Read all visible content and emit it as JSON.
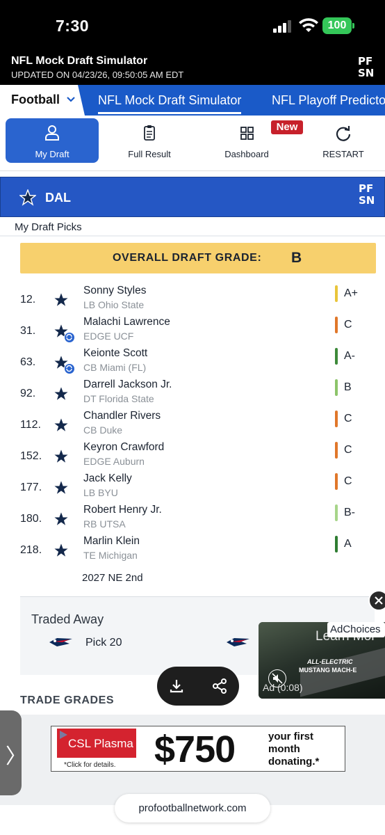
{
  "status_bar": {
    "time": "7:30",
    "battery": "100"
  },
  "app_header": {
    "title": "NFL Mock Draft Simulator",
    "updated": "UPDATED ON 04/23/26, 09:50:05 AM EDT",
    "logo_top": "PF",
    "logo_bottom": "SN"
  },
  "nav": {
    "sport": "Football",
    "tabs": [
      {
        "label": "NFL Mock Draft Simulator",
        "active": true
      },
      {
        "label": "NFL Playoff Predictor",
        "active": false
      }
    ]
  },
  "toolbar": {
    "items": [
      {
        "label": "My Draft",
        "icon": "user-icon",
        "active": true
      },
      {
        "label": "Full Result",
        "icon": "clipboard-icon",
        "active": false
      },
      {
        "label": "Dashboard",
        "icon": "dashboard-icon",
        "active": false
      },
      {
        "label": "RESTART",
        "icon": "restart-icon",
        "active": false
      }
    ],
    "new_badge": "New"
  },
  "team": {
    "abbr": "DAL"
  },
  "section_label": "My Draft Picks",
  "overall_grade": {
    "label": "OVERALL DRAFT GRADE:",
    "value": "B"
  },
  "picks": [
    {
      "num": "12.",
      "name": "Sonny Styles",
      "sub": "LB Ohio State",
      "grade": "A+",
      "grade_color": "#e9c53b",
      "traded": false
    },
    {
      "num": "31.",
      "name": "Malachi Lawrence",
      "sub": "EDGE UCF",
      "grade": "C",
      "grade_color": "#e0772a",
      "traded": true
    },
    {
      "num": "63.",
      "name": "Keionte Scott",
      "sub": "CB Miami (FL)",
      "grade": "A-",
      "grade_color": "#3d8a3a",
      "traded": true
    },
    {
      "num": "92.",
      "name": "Darrell Jackson Jr.",
      "sub": "DT Florida State",
      "grade": "B",
      "grade_color": "#8cc46a",
      "traded": false
    },
    {
      "num": "112.",
      "name": "Chandler Rivers",
      "sub": "CB Duke",
      "grade": "C",
      "grade_color": "#e0772a",
      "traded": false
    },
    {
      "num": "152.",
      "name": "Keyron Crawford",
      "sub": "EDGE Auburn",
      "grade": "C",
      "grade_color": "#e0772a",
      "traded": false
    },
    {
      "num": "177.",
      "name": "Jack Kelly",
      "sub": "LB BYU",
      "grade": "C",
      "grade_color": "#e0772a",
      "traded": false
    },
    {
      "num": "180.",
      "name": "Robert Henry Jr.",
      "sub": "RB UTSA",
      "grade": "B-",
      "grade_color": "#a7d58a",
      "traded": false
    },
    {
      "num": "218.",
      "name": "Marlin Klein",
      "sub": "TE Michigan",
      "grade": "A",
      "grade_color": "#2f7d32",
      "traded": false
    }
  ],
  "future_pick": "2027 NE 2nd",
  "traded_away": {
    "title": "Traded Away",
    "pick": "Pick 20"
  },
  "trade_grades": "TRADE GRADES",
  "video_ad": {
    "learn": "Learn Mor",
    "tag1": "ALL-ELECTRIC",
    "tag2": "MUSTANG MACH-E",
    "time": "Ad (0:08)",
    "adchoices": "AdChoices"
  },
  "banner_ad": {
    "brand": "CSL Plasma",
    "click": "*Click for details.",
    "amount": "$750",
    "tagline": "your first month donating.*"
  },
  "url": "profootballnetwork.com"
}
